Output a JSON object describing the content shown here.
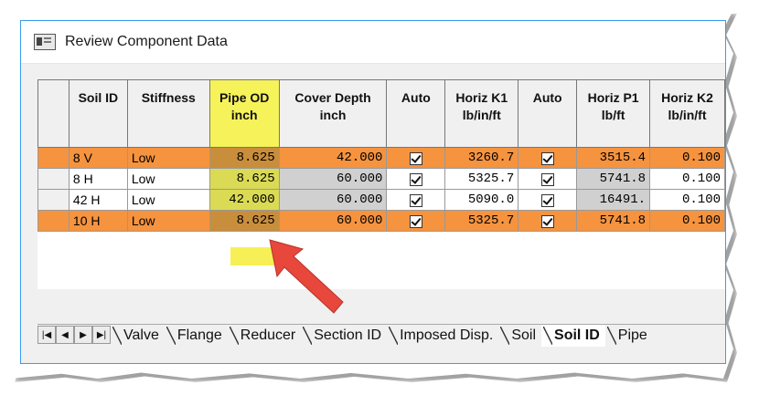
{
  "window": {
    "title": "Review Component Data",
    "icon": "form-window-icon"
  },
  "grid": {
    "columns": [
      {
        "label": "",
        "line2": ""
      },
      {
        "label": "Soil ID",
        "line2": ""
      },
      {
        "label": "Stiffness",
        "line2": ""
      },
      {
        "label": "Pipe OD",
        "line2": "inch"
      },
      {
        "label": "Cover Depth",
        "line2": "inch"
      },
      {
        "label": "Auto",
        "line2": ""
      },
      {
        "label": "Horiz K1",
        "line2": "lb/in/ft"
      },
      {
        "label": "Auto",
        "line2": ""
      },
      {
        "label": "Horiz P1",
        "line2": "lb/ft"
      },
      {
        "label": "Horiz K2",
        "line2": "lb/in/ft"
      }
    ],
    "rows": [
      {
        "soil_id": "8 V",
        "stiffness": "Low",
        "pipe_od": "8.625",
        "cover_depth": "42.000",
        "auto1": true,
        "horiz_k1": "3260.7",
        "auto2": true,
        "horiz_p1": "3515.4",
        "horiz_k2": "0.100",
        "highlighted": true
      },
      {
        "soil_id": "8 H",
        "stiffness": "Low",
        "pipe_od": "8.625",
        "cover_depth": "60.000",
        "auto1": true,
        "horiz_k1": "5325.7",
        "auto2": true,
        "horiz_p1": "5741.8",
        "horiz_k2": "0.100",
        "highlighted": false
      },
      {
        "soil_id": "42 H",
        "stiffness": "Low",
        "pipe_od": "42.000",
        "cover_depth": "60.000",
        "auto1": true,
        "horiz_k1": "5090.0",
        "auto2": true,
        "horiz_p1": "16491.",
        "horiz_k2": "0.100",
        "highlighted": false
      },
      {
        "soil_id": "10 H",
        "stiffness": "Low",
        "pipe_od": "8.625",
        "cover_depth": "60.000",
        "auto1": true,
        "horiz_k1": "5325.7",
        "auto2": true,
        "horiz_p1": "5741.8",
        "horiz_k2": "0.100",
        "highlighted": true
      }
    ]
  },
  "tabs": {
    "nav": [
      "|◀",
      "◀",
      "▶",
      "▶|"
    ],
    "items": [
      {
        "label": "Valve",
        "active": false
      },
      {
        "label": "Flange",
        "active": false
      },
      {
        "label": "Reducer",
        "active": false
      },
      {
        "label": "Section ID",
        "active": false
      },
      {
        "label": "Imposed Disp.",
        "active": false
      },
      {
        "label": "Soil",
        "active": false
      },
      {
        "label": "Soil ID",
        "active": true
      },
      {
        "label": "Pipe",
        "active": false
      }
    ]
  },
  "annotation": {
    "highlight_color": "#f5933f",
    "column_highlight_color": "#f6f25a",
    "arrow_color": "#e8473c"
  }
}
